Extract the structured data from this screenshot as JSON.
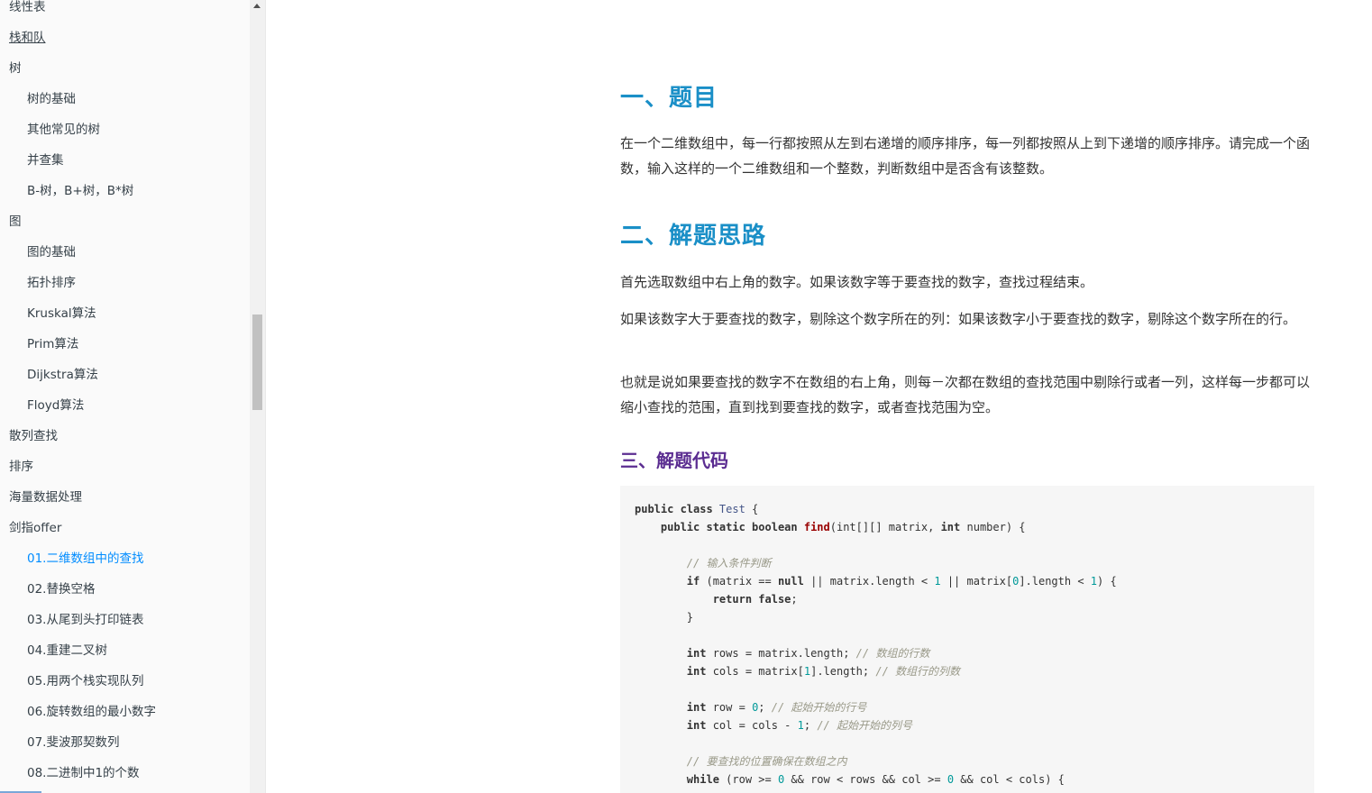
{
  "sidebar": {
    "items": [
      {
        "label": "线性表",
        "level": 0
      },
      {
        "label": "栈和队",
        "level": 0,
        "underlined": true
      },
      {
        "label": "树",
        "level": 0
      },
      {
        "label": "树的基础",
        "level": 1
      },
      {
        "label": "其他常见的树",
        "level": 1
      },
      {
        "label": "并查集",
        "level": 1
      },
      {
        "label": "B-树，B+树，B*树",
        "level": 1
      },
      {
        "label": "图",
        "level": 0
      },
      {
        "label": "图的基础",
        "level": 1
      },
      {
        "label": "拓扑排序",
        "level": 1
      },
      {
        "label": "Kruskal算法",
        "level": 1
      },
      {
        "label": "Prim算法",
        "level": 1
      },
      {
        "label": "Dijkstra算法",
        "level": 1
      },
      {
        "label": "Floyd算法",
        "level": 1
      },
      {
        "label": "散列查找",
        "level": 0
      },
      {
        "label": "排序",
        "level": 0
      },
      {
        "label": "海量数据处理",
        "level": 0
      },
      {
        "label": "剑指offer",
        "level": 0
      },
      {
        "label": "01.二维数组中的查找",
        "level": 1,
        "active": true
      },
      {
        "label": "02.替换空格",
        "level": 1
      },
      {
        "label": "03.从尾到头打印链表",
        "level": 1
      },
      {
        "label": "04.重建二叉树",
        "level": 1
      },
      {
        "label": "05.用两个栈实现队列",
        "level": 1
      },
      {
        "label": "06.旋转数组的最小数字",
        "level": 1
      },
      {
        "label": "07.斐波那契数列",
        "level": 1
      },
      {
        "label": "08.二进制中1的个数",
        "level": 1
      }
    ],
    "active_color": "#008cff"
  },
  "article": {
    "section1_title": "一、题目",
    "section1_text": "在一个二维数组中，每一行都按照从左到右递增的顺序排序，每一列都按照从上到下递增的顺序排序。请完成一个函数，输入这样的一个二维数组和一个整数，判断数组中是否含有该整数。",
    "section2_title": "二、解题思路",
    "section2_p1": "首先选取数组中右上角的数字。如果该数字等于要查找的数字，查找过程结束。",
    "section2_p2": "如果该数字大于要查找的数字，剔除这个数字所在的列：如果该数字小于要查找的数字，剔除这个数字所在的行。",
    "section2_p3": "也就是说如果要查找的数字不在数组的右上角，则每－次都在数组的查找范围中剔除行或者一列，这样每一步都可以缩小查找的范围，直到找到要查找的数字，或者查找范围为空。",
    "section3_title": "三、解题代码",
    "heading_color": "#1a8fc7",
    "subheading_color": "#5b2d91"
  },
  "code": {
    "lines": [
      [
        {
          "t": "public class ",
          "c": "kw"
        },
        {
          "t": "Test",
          "c": "ty"
        },
        {
          "t": " {",
          "c": ""
        }
      ],
      [
        {
          "t": "    public static boolean ",
          "c": "kw"
        },
        {
          "t": "find",
          "c": "fn"
        },
        {
          "t": "(int[][] matrix, ",
          "c": ""
        },
        {
          "t": "int",
          "c": "kw"
        },
        {
          "t": " number) {",
          "c": ""
        }
      ],
      [],
      [
        {
          "t": "        // 输入条件判断",
          "c": "cm"
        }
      ],
      [
        {
          "t": "        if",
          "c": "kw"
        },
        {
          "t": " (matrix == ",
          "c": ""
        },
        {
          "t": "null",
          "c": "kw"
        },
        {
          "t": " || matrix.length < ",
          "c": ""
        },
        {
          "t": "1",
          "c": "num"
        },
        {
          "t": " || matrix[",
          "c": ""
        },
        {
          "t": "0",
          "c": "num"
        },
        {
          "t": "].length < ",
          "c": ""
        },
        {
          "t": "1",
          "c": "num"
        },
        {
          "t": ") {",
          "c": ""
        }
      ],
      [
        {
          "t": "            return false",
          "c": "kw"
        },
        {
          "t": ";",
          "c": ""
        }
      ],
      [
        {
          "t": "        }",
          "c": ""
        }
      ],
      [],
      [
        {
          "t": "        int",
          "c": "kw"
        },
        {
          "t": " rows = matrix.length; ",
          "c": ""
        },
        {
          "t": "// 数组的行数",
          "c": "cm"
        }
      ],
      [
        {
          "t": "        int",
          "c": "kw"
        },
        {
          "t": " cols = matrix[",
          "c": ""
        },
        {
          "t": "1",
          "c": "num"
        },
        {
          "t": "].length; ",
          "c": ""
        },
        {
          "t": "// 数组行的列数",
          "c": "cm"
        }
      ],
      [],
      [
        {
          "t": "        int",
          "c": "kw"
        },
        {
          "t": " row = ",
          "c": ""
        },
        {
          "t": "0",
          "c": "num"
        },
        {
          "t": "; ",
          "c": ""
        },
        {
          "t": "// 起始开始的行号",
          "c": "cm"
        }
      ],
      [
        {
          "t": "        int",
          "c": "kw"
        },
        {
          "t": " col = cols - ",
          "c": ""
        },
        {
          "t": "1",
          "c": "num"
        },
        {
          "t": "; ",
          "c": ""
        },
        {
          "t": "// 起始开始的列号",
          "c": "cm"
        }
      ],
      [],
      [
        {
          "t": "        // 要查找的位置确保在数组之内",
          "c": "cm"
        }
      ],
      [
        {
          "t": "        while",
          "c": "kw"
        },
        {
          "t": " (row >= ",
          "c": ""
        },
        {
          "t": "0",
          "c": "num"
        },
        {
          "t": " && row < rows && col >= ",
          "c": ""
        },
        {
          "t": "0",
          "c": "num"
        },
        {
          "t": " && col < cols) {",
          "c": ""
        }
      ]
    ]
  }
}
